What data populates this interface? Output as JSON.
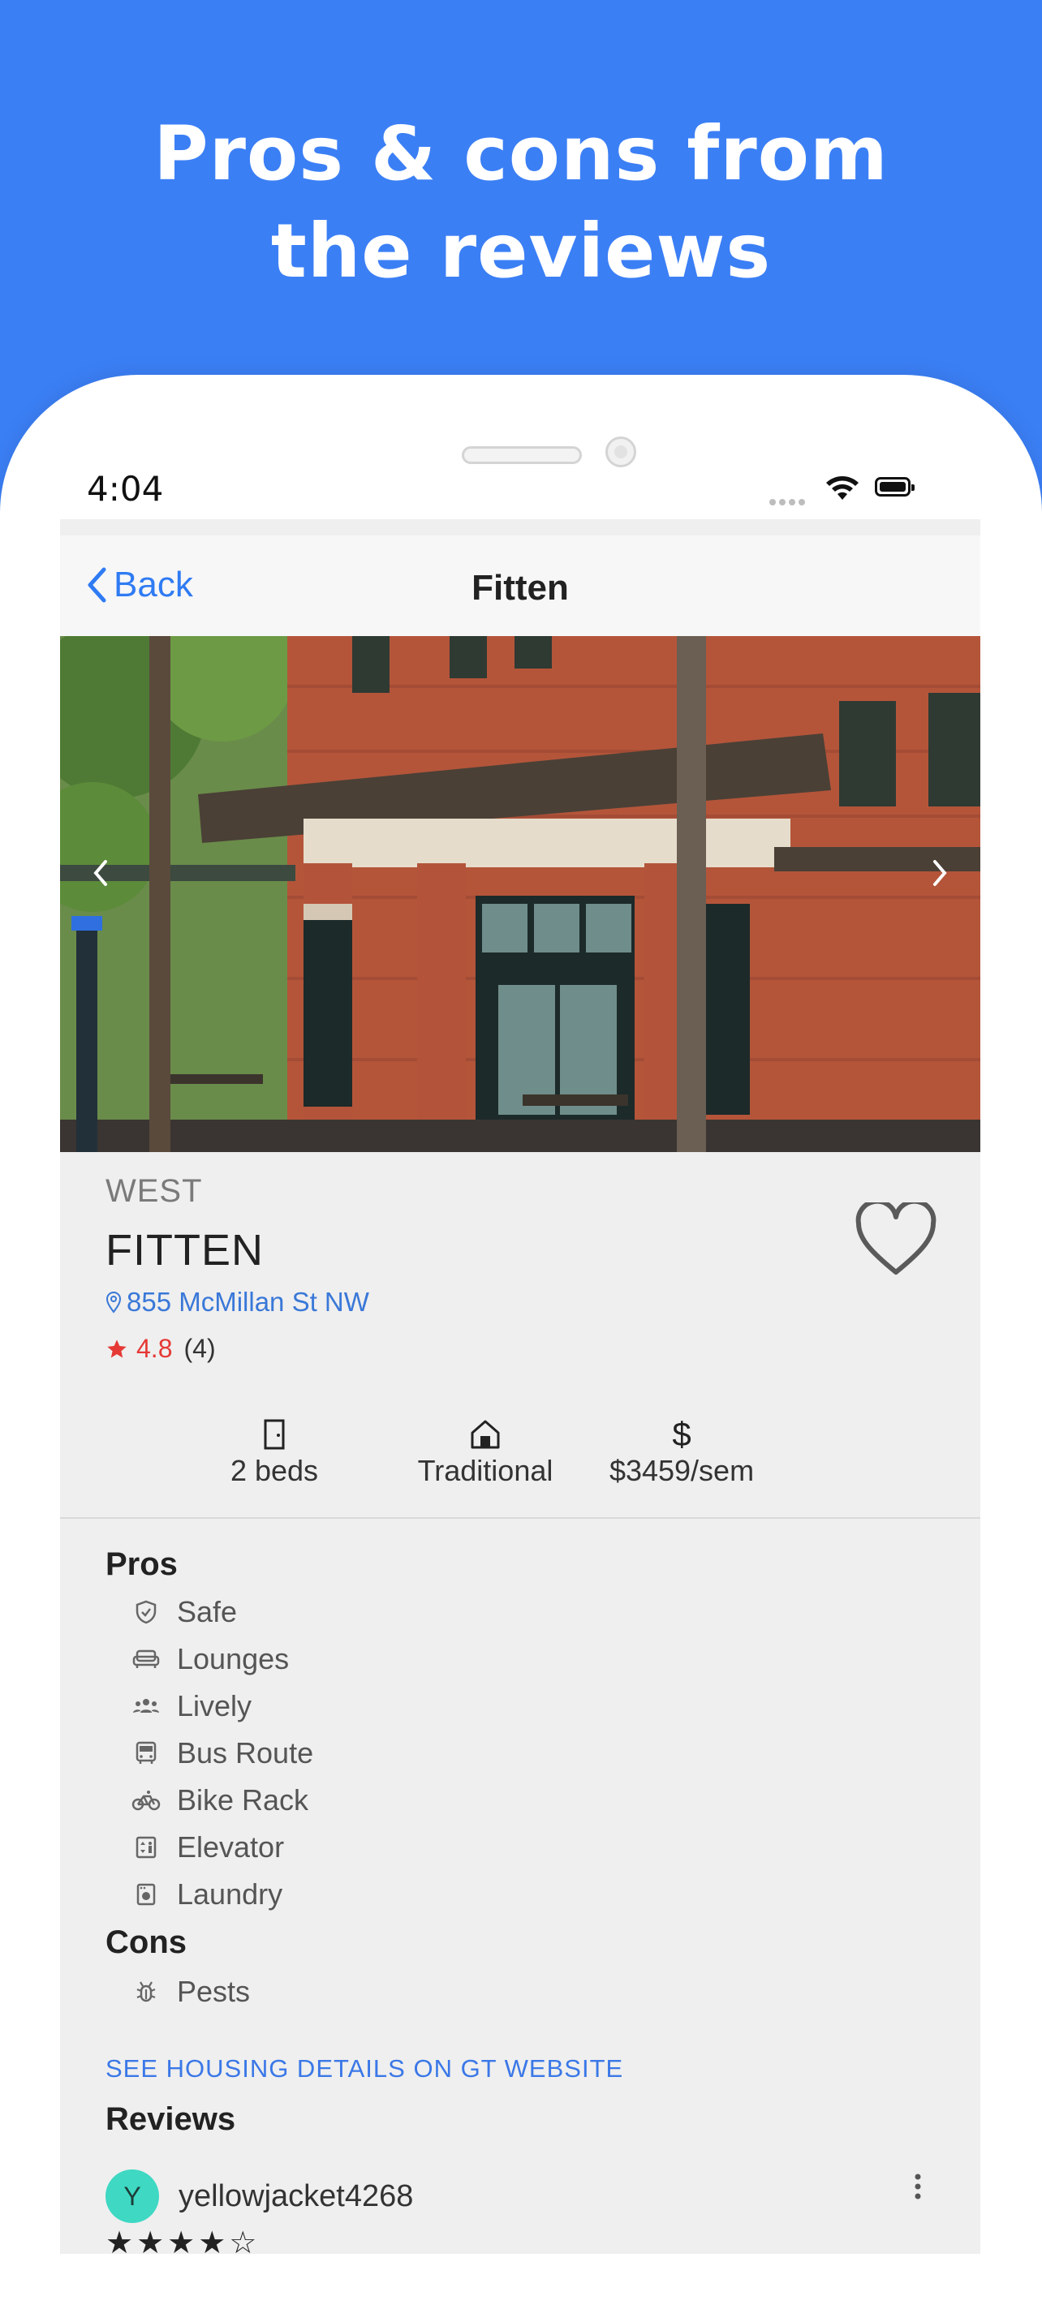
{
  "headline": {
    "line1": "Pros & cons from",
    "line2": "the reviews"
  },
  "status_bar": {
    "time": "4:04"
  },
  "nav": {
    "back_label": "Back",
    "title": "Fitten"
  },
  "listing": {
    "region": "WEST",
    "name": "FITTEN",
    "address": "855 McMillan St NW",
    "rating": "4.8",
    "review_count": "(4)"
  },
  "stats": [
    {
      "icon": "door-icon",
      "label": "2 beds"
    },
    {
      "icon": "house-icon",
      "label": "Traditional"
    },
    {
      "icon": "dollar-icon",
      "label": "$3459/sem"
    }
  ],
  "pros": {
    "heading": "Pros",
    "items": [
      {
        "icon": "shield-icon",
        "label": "Safe"
      },
      {
        "icon": "sofa-icon",
        "label": "Lounges"
      },
      {
        "icon": "people-icon",
        "label": "Lively"
      },
      {
        "icon": "bus-icon",
        "label": "Bus Route"
      },
      {
        "icon": "bike-icon",
        "label": "Bike Rack"
      },
      {
        "icon": "elevator-icon",
        "label": "Elevator"
      },
      {
        "icon": "laundry-icon",
        "label": "Laundry"
      }
    ]
  },
  "cons": {
    "heading": "Cons",
    "items": [
      {
        "icon": "bug-icon",
        "label": "Pests"
      }
    ]
  },
  "details_link": "SEE HOUSING DETAILS ON GT WEBSITE",
  "reviews": {
    "heading": "Reviews",
    "first": {
      "avatar_letter": "Y",
      "username": "yellowjacket4268",
      "stars": 4,
      "stars_text": "★★★★☆"
    }
  },
  "colors": {
    "background": "#3b7ff5",
    "accent": "#2f7bf3",
    "rating": "#e53935",
    "avatar": "#3ed8c3"
  }
}
